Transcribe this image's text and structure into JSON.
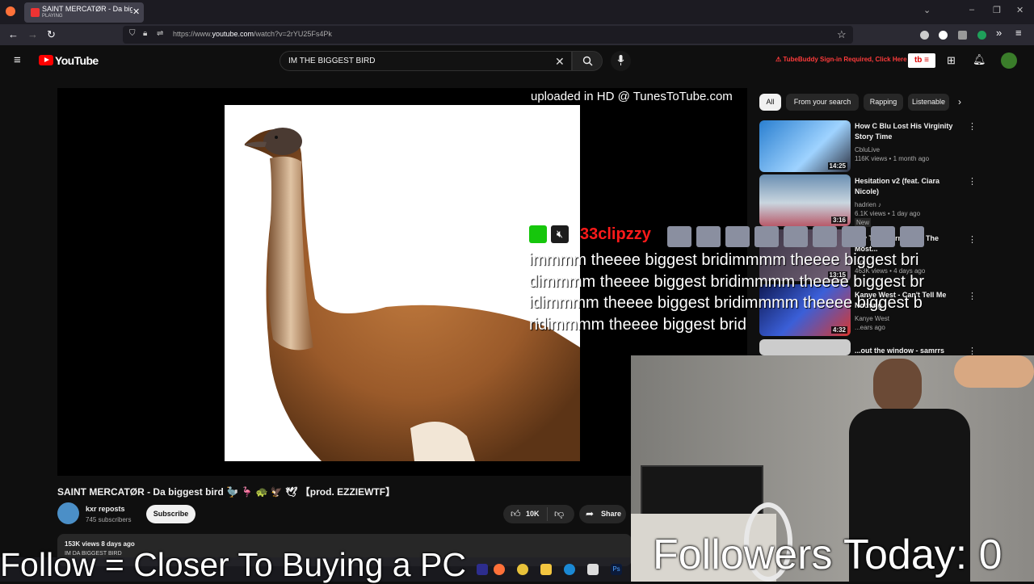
{
  "browser": {
    "tab_title": "SAINT MERCATØR - Da biggest",
    "tab_status": "PLAYING",
    "url_prefix": "https://www.",
    "url_domain": "youtube.com",
    "url_path": "/watch?v=2rYU25Fs4Pk",
    "nav_icons": [
      "back-icon",
      "forward-icon",
      "reload-icon"
    ],
    "window_controls": [
      "chevron-down-icon",
      "minimize-icon",
      "restore-icon",
      "close-icon"
    ]
  },
  "youtube_header": {
    "logo_text": "YouTube",
    "search_value": "IM THE BIGGEST BIRD",
    "tubebuddy_warning": "TubeBuddy Sign-in Required, Click Here",
    "tubebuddy_logo": "tb"
  },
  "player": {
    "watermark": "uploaded in HD @ TunesToTube.com"
  },
  "video": {
    "title": "SAINT MERCATØR - Da biggest bird 🦤 🦩 🐢 🦅 🕊 【prod. EZZIEWTF】",
    "channel_name": "kxr reposts",
    "channel_subs": "745 subscribers",
    "subscribe_label": "Subscribe",
    "likes": "10K",
    "share_label": "Share",
    "views_date": "153K views  8 days ago",
    "description": "IM DA BIGGEST BIRD"
  },
  "sidebar": {
    "chips": [
      "All",
      "From your search",
      "Rapping",
      "Listenable"
    ],
    "recommendations": [
      {
        "title": "How C Blu Lost His Virginity Story Time",
        "channel": "CbluLive",
        "meta": "116K views • 1 month ago",
        "duration": "14:25"
      },
      {
        "title": "Hesitation v2 (feat. Ciara Nicole)",
        "channel": "hadrien ♪",
        "meta": "6.1K views • 1 day ago",
        "badge": "New",
        "duration": "3:16"
      },
      {
        "title": "...ly Transforms Into The Most...",
        "channel": "...n",
        "meta": "463K views • 4 days ago",
        "duration": "13:15"
      },
      {
        "title": "Kanye West - Can't Tell Me Nothing",
        "channel": "Kanye West",
        "meta": "...ears ago",
        "duration": "4:32"
      },
      {
        "title": "...out the window - samrrs (sped",
        "channel": "",
        "meta": "",
        "duration": ""
      }
    ]
  },
  "stream_overlay": {
    "chat_user": "33clipzzy",
    "chat_message": "immmm theeee biggest bridimmmm theeee biggest bridimmmm theeee biggest bridimmmm theeee biggest bridimmmm theeee biggest bridimmmm theeee biggest bridimmmm theeee biggest brid",
    "follow_text": "Follow = Closer To Buying a PC",
    "followers_today": "Followers Today: 0"
  },
  "colors": {
    "youtube_red": "#ff0000",
    "chat_user": "#ff1a1a",
    "tubebuddy_warning": "#ff3b3b"
  }
}
